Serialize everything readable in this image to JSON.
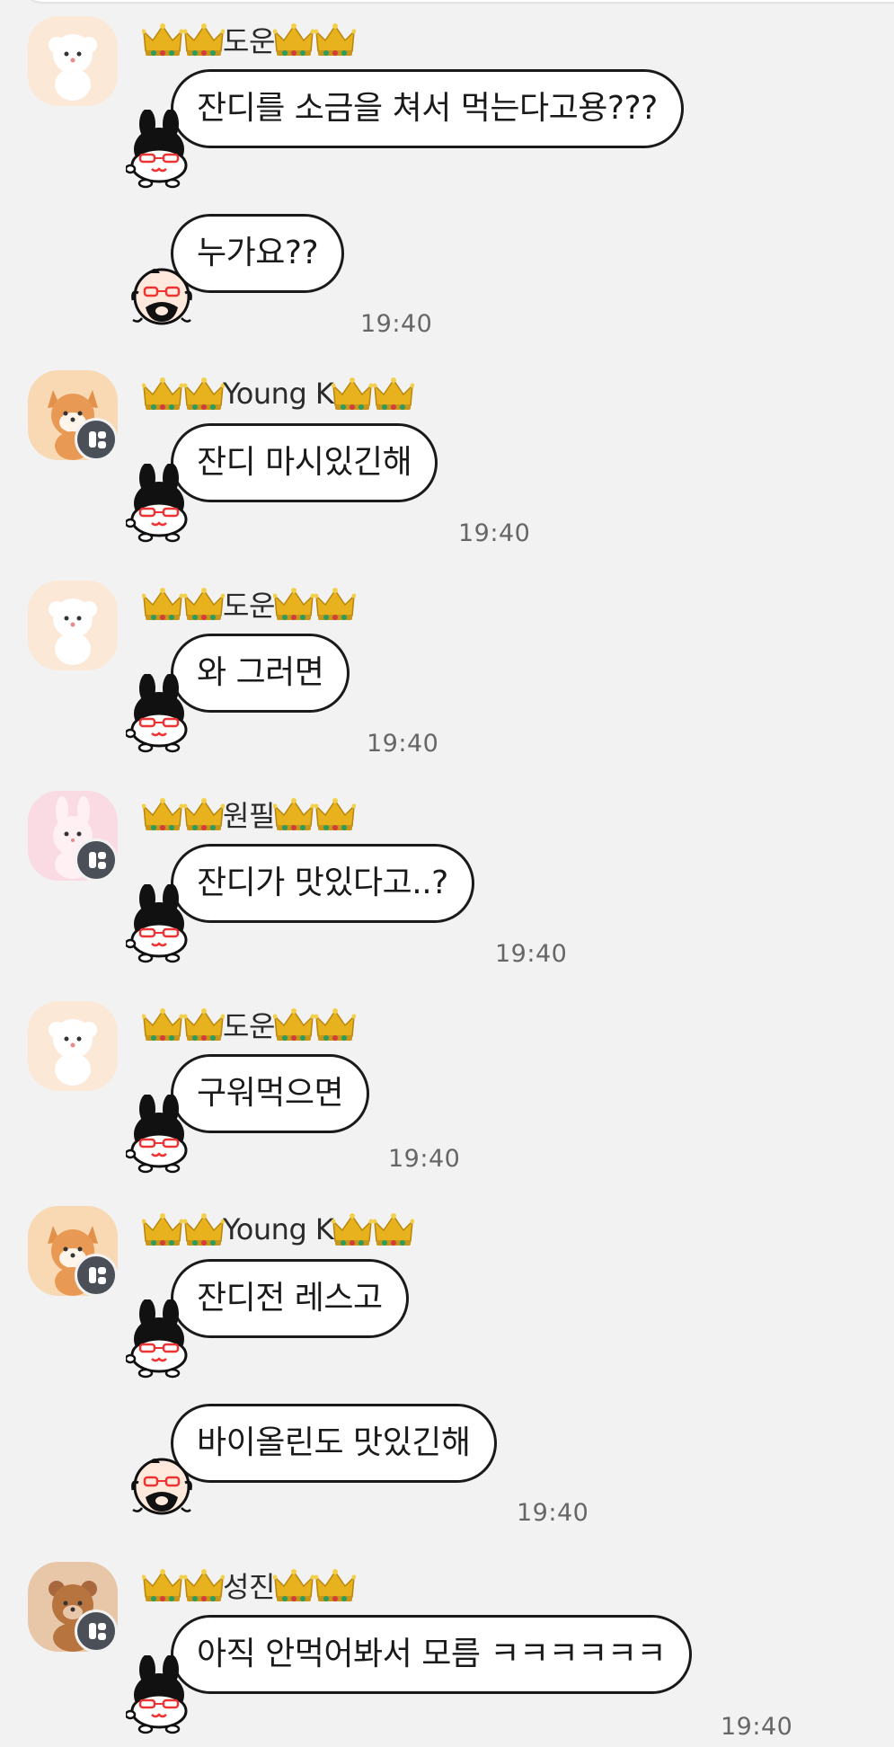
{
  "colors": {
    "background": "#f2f2f2",
    "bubble_bg": "#ffffff",
    "bubble_border": "#1a1a1a",
    "time_text": "#666666",
    "badge_bg": "#4b4f57"
  },
  "icons": {
    "crown": "crown-icon",
    "sticker_bunny": "bunny-sticker",
    "sticker_face": "mustache-face-sticker",
    "badge": "device-badge-icon"
  },
  "messages": [
    {
      "sender": "도운",
      "avatar": "white-puppy-avatar",
      "badge": false,
      "bubbles": [
        {
          "text": "잔디를 소금을 쳐서 먹는다고용???",
          "sticker": "bunny"
        },
        {
          "text": "누가요??",
          "sticker": "face"
        }
      ],
      "time": "19:40"
    },
    {
      "sender": "Young K",
      "avatar": "shiba-avatar",
      "badge": true,
      "bubbles": [
        {
          "text": "잔디 마시있긴해",
          "sticker": "bunny"
        }
      ],
      "time": "19:40"
    },
    {
      "sender": "도운",
      "avatar": "white-puppy-avatar",
      "badge": false,
      "bubbles": [
        {
          "text": "와 그러면",
          "sticker": "bunny"
        }
      ],
      "time": "19:40"
    },
    {
      "sender": "원필",
      "avatar": "pink-bunny-avatar",
      "badge": true,
      "bubbles": [
        {
          "text": "잔디가 맛있다고..?",
          "sticker": "bunny"
        }
      ],
      "time": "19:40"
    },
    {
      "sender": "도운",
      "avatar": "white-puppy-avatar",
      "badge": false,
      "bubbles": [
        {
          "text": "구워먹으면",
          "sticker": "bunny"
        }
      ],
      "time": "19:40"
    },
    {
      "sender": "Young K",
      "avatar": "shiba-avatar",
      "badge": true,
      "bubbles": [
        {
          "text": "잔디전 레스고",
          "sticker": "bunny"
        },
        {
          "text": "바이올린도 맛있긴해",
          "sticker": "face"
        }
      ],
      "time": "19:40"
    },
    {
      "sender": "성진",
      "avatar": "brown-bear-avatar",
      "badge": true,
      "bubbles": [
        {
          "text": "아직 안먹어봐서 모름 ㅋㅋㅋㅋㅋㅋ",
          "sticker": "bunny"
        }
      ],
      "time": "19:40"
    }
  ]
}
